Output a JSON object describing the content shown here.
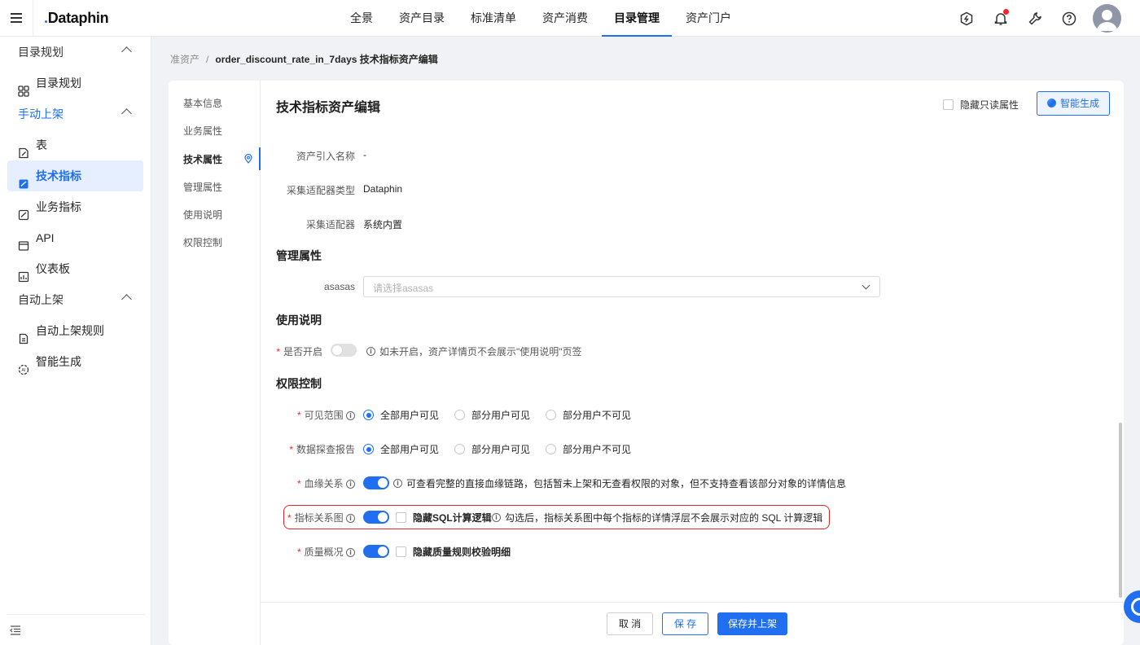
{
  "header": {
    "logo": "Dataphin",
    "nav": [
      "全景",
      "资产目录",
      "标准清单",
      "资产消费",
      "目录管理",
      "资产门户"
    ],
    "active_nav": "目录管理",
    "icons": [
      "power-icon",
      "bell-icon",
      "wrench-icon",
      "help-icon"
    ]
  },
  "sidebar": {
    "group1": "目录规划",
    "item_catalog": "目录规划",
    "group2": "手动上架",
    "item_table": "表",
    "item_tech_metric": "技术指标",
    "item_biz_metric": "业务指标",
    "item_api": "API",
    "item_dashboard": "仪表板",
    "group3": "自动上架",
    "item_auto_rules": "自动上架规则",
    "item_smart_gen": "智能生成"
  },
  "breadcrumb": {
    "parent": "准资产",
    "separator": "/",
    "current": "order_discount_rate_in_7days 技术指标资产编辑"
  },
  "anchor_nav": [
    "基本信息",
    "业务属性",
    "技术属性",
    "管理属性",
    "使用说明",
    "权限控制"
  ],
  "page": {
    "title": "技术指标资产编辑",
    "hide_readonly": "隐藏只读属性",
    "smart_generate": "智能生成"
  },
  "tech_attrs": {
    "asset_ref_label": "资产引入名称",
    "asset_ref_value": "-",
    "adapter_type_label": "采集适配器类型",
    "adapter_type_value": "Dataphin",
    "adapter_label": "采集适配器",
    "adapter_value": "系统内置"
  },
  "mgmt": {
    "section": "管理属性",
    "field_label": "asasas",
    "placeholder": "请选择asasas"
  },
  "usage": {
    "section": "使用说明",
    "enable_label": "是否开启",
    "enabled": false,
    "note": "如未开启，资产详情页不会展示\"使用说明\"页签"
  },
  "perm": {
    "section": "权限控制",
    "visibility_label": "可见范围",
    "explore_label": "数据探查报告",
    "options": [
      "全部用户可见",
      "部分用户可见",
      "部分用户不可见"
    ],
    "visibility_selected": "全部用户可见",
    "explore_selected": "全部用户可见",
    "lineage_label": "血缘关系",
    "lineage_on": true,
    "lineage_note": "可查看完整的直接血缘链路，包括暂未上架和无查看权限的对象，但不支持查看该部分对象的详情信息",
    "metric_graph_label": "指标关系图",
    "metric_graph_on": true,
    "hide_sql": "隐藏SQL计算逻辑",
    "hide_sql_note": "勾选后，指标关系图中每个指标的详情浮层不会展示对应的 SQL 计算逻辑",
    "quality_label": "质量概况",
    "quality_on": true,
    "hide_quality": "隐藏质量规则校验明细"
  },
  "footer": {
    "cancel": "取 消",
    "save": "保 存",
    "save_publish": "保存并上架"
  },
  "colors": {
    "accent": "#1f6ff0",
    "highlight_border": "#e02424",
    "required": "#f5222d"
  }
}
